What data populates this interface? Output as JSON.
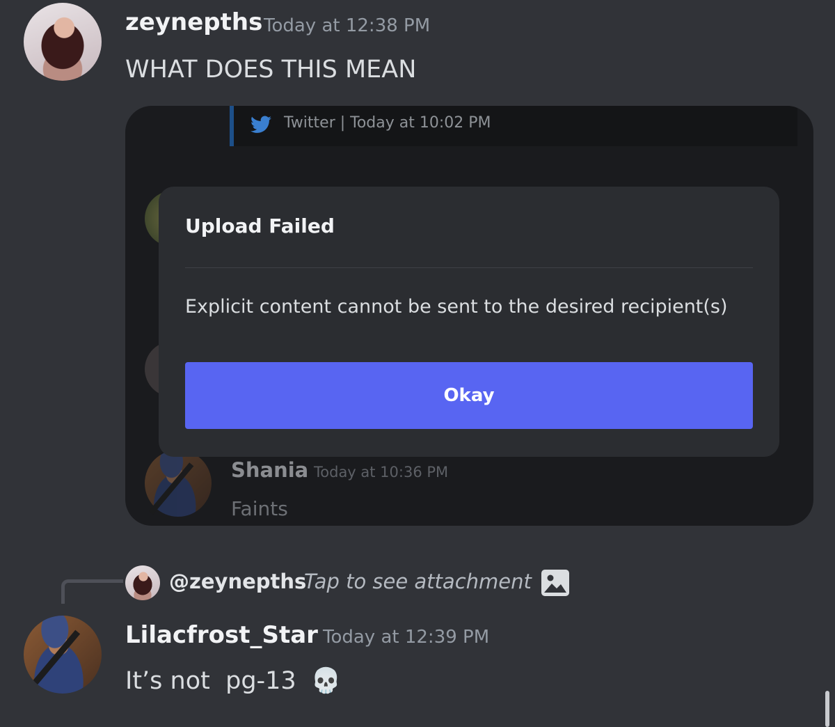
{
  "messages": [
    {
      "username": "zeynepths",
      "timestamp": "Today at 12:38 PM",
      "text": "WHAT DOES THIS MEAN"
    },
    {
      "username": "Lilacfrost_Star",
      "timestamp": "Today at 12:39 PM",
      "text": "It’s not  pg-13",
      "emoji": "💀",
      "reply": {
        "mention": "@zeynepths",
        "text": "Tap to see attachment"
      }
    }
  ],
  "attachment": {
    "embed_source": "Twitter | Today at 10:02 PM",
    "dialog": {
      "title": "Upload Failed",
      "body": "Explicit content cannot be sent to the desired recipient(s)",
      "button": "Okay"
    },
    "message": {
      "username": "Shania",
      "timestamp": "Today at 10:36 PM",
      "text": "Faints"
    }
  },
  "colors": {
    "background": "#313338",
    "button": "#5865f2",
    "twitter_border": "#1d4f89"
  },
  "icons": [
    "twitter-bird-icon",
    "image-icon",
    "skull-emoji"
  ]
}
